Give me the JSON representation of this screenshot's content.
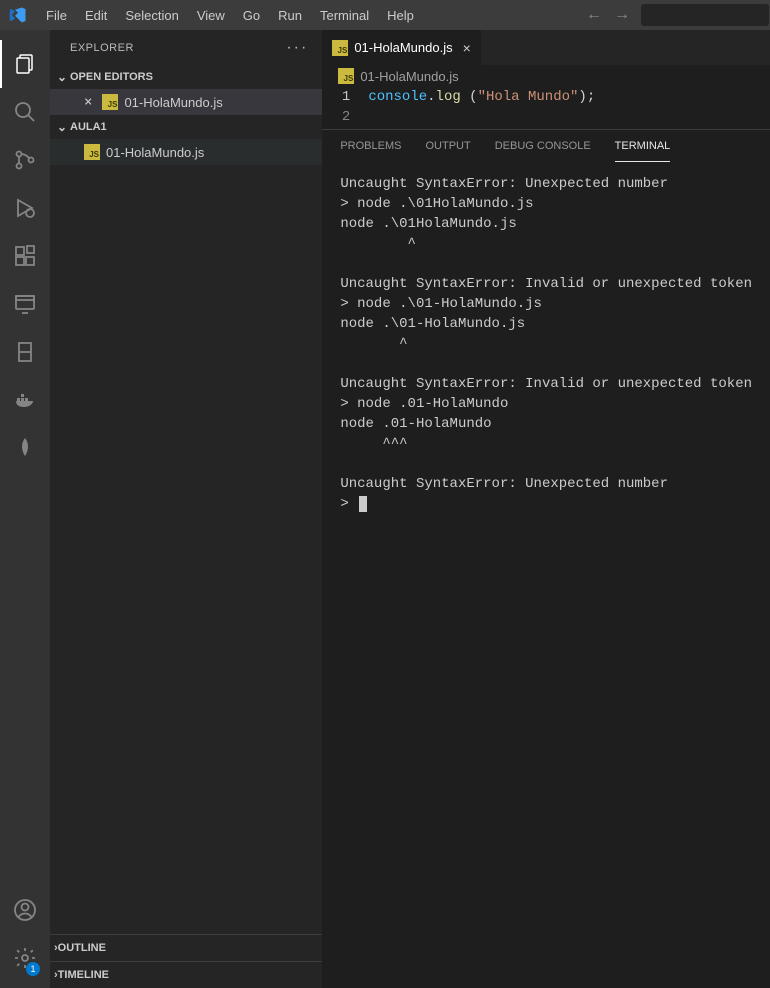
{
  "menu": {
    "file": "File",
    "edit": "Edit",
    "selection": "Selection",
    "view": "View",
    "go": "Go",
    "run": "Run",
    "terminal": "Terminal",
    "help": "Help"
  },
  "activitybar": {
    "badge": "1"
  },
  "sidebar": {
    "title": "EXPLORER",
    "open_editors_label": "OPEN EDITORS",
    "folder_label": "AULA1",
    "outline_label": "OUTLINE",
    "timeline_label": "TIMELINE",
    "open_file": "01-HolaMundo.js",
    "tree_file": "01-HolaMundo.js",
    "js_badge": "JS"
  },
  "editor": {
    "tab_label": "01-HolaMundo.js",
    "breadcrumb": "01-HolaMundo.js",
    "lines": {
      "n1": "1",
      "n2": "2"
    },
    "code": {
      "obj": "console",
      "dot": ".",
      "fn": "log",
      "sp": " ",
      "lp": "(",
      "str": "\"Hola Mundo\"",
      "rp": ")",
      "semi": ";"
    }
  },
  "panel": {
    "tabs": {
      "problems": "PROBLEMS",
      "output": "OUTPUT",
      "debug": "DEBUG CONSOLE",
      "terminal": "TERMINAL"
    },
    "terminal_text": "Uncaught SyntaxError: Unexpected number\n> node .\\01HolaMundo.js\nnode .\\01HolaMundo.js\n        ^\n\nUncaught SyntaxError: Invalid or unexpected token\n> node .\\01-HolaMundo.js\nnode .\\01-HolaMundo.js\n       ^\n\nUncaught SyntaxError: Invalid or unexpected token\n> node .01-HolaMundo\nnode .01-HolaMundo\n     ^^^\n\nUncaught SyntaxError: Unexpected number\n> "
  }
}
